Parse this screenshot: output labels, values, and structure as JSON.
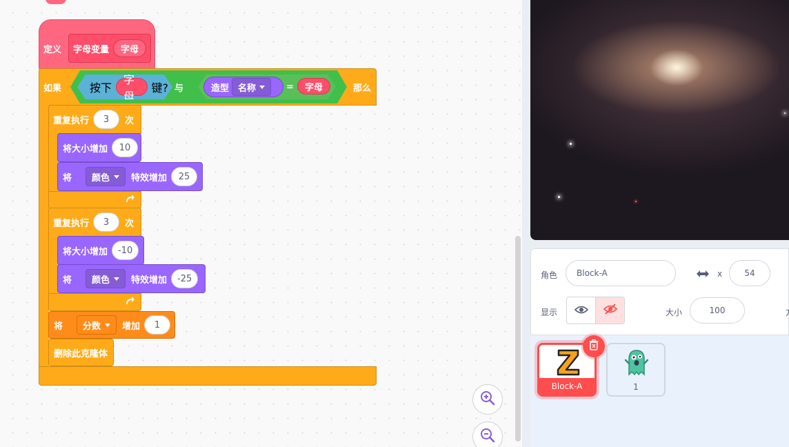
{
  "code": {
    "define": {
      "keyword": "定义",
      "proc_name": "字母变量",
      "param": "字母"
    },
    "if_block": {
      "if_label": "如果",
      "then_label": "那么",
      "key_pressed": {
        "prefix": "按下",
        "param": "字母",
        "suffix": "键?"
      },
      "and_label": "与",
      "costume": {
        "label": "造型",
        "dropdown": "名称",
        "equals": "=",
        "param": "字母"
      }
    },
    "loop1": {
      "label": "重复执行",
      "count": "3",
      "unit": "次"
    },
    "change_size_1": {
      "label": "将大小增加",
      "value": "10"
    },
    "effect_1": {
      "prefix": "将",
      "dropdown": "颜色",
      "suffix": "特效增加",
      "value": "25"
    },
    "loop2": {
      "label": "重复执行",
      "count": "3",
      "unit": "次"
    },
    "change_size_2": {
      "label": "将大小增加",
      "value": "-10"
    },
    "effect_2": {
      "prefix": "将",
      "dropdown": "颜色",
      "suffix": "特效增加",
      "value": "-25"
    },
    "change_var": {
      "prefix": "将",
      "dropdown": "分数",
      "suffix": "增加",
      "value": "1"
    },
    "delete_clone": {
      "label": "删除此克隆体"
    },
    "loop_arrow_icon": "loop-arrow-icon"
  },
  "zoom": {
    "in_icon": "zoom-in-icon",
    "out_icon": "zoom-out-icon"
  },
  "sprite_info": {
    "sprite_label": "角色",
    "sprite_name": "Block-A",
    "x_label": "x",
    "x_value": "54",
    "show_label": "显示",
    "size_label": "大小",
    "size_value": "100",
    "cut_label": "方"
  },
  "sprites": [
    {
      "name": "Block-A",
      "selected": true,
      "icon": "letter-z-sprite"
    },
    {
      "name": "1",
      "selected": false,
      "icon": "green-monster-sprite"
    }
  ],
  "colors": {
    "events_pink": "#ff6680",
    "control_orange": "#ffab19",
    "looks_purple": "#9966ff",
    "sensing_blue": "#5cb1d6",
    "operators_green": "#59c059",
    "variables_orange": "#ff8c1a",
    "selected_red": "#ff4c4c"
  }
}
